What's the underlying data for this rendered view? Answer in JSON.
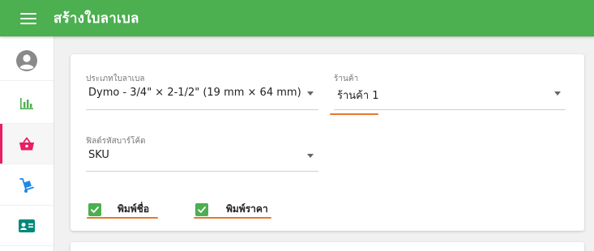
{
  "appbar": {
    "title": "สร้างใบลาเบล",
    "menu_icon": "hamburger-menu-icon"
  },
  "sidebar": {
    "accent": "#e91e63",
    "items": [
      {
        "icon": "user-profile-icon",
        "color": "#888888",
        "active": false
      },
      {
        "icon": "bar-chart-icon",
        "color": "#4caf50",
        "active": false
      },
      {
        "icon": "shopping-basket-icon",
        "color": "#e91e63",
        "active": true
      },
      {
        "icon": "hand-truck-icon",
        "color": "#1e88e5",
        "active": false
      },
      {
        "icon": "id-card-icon",
        "color": "#00897b",
        "active": false
      }
    ]
  },
  "form": {
    "label_type": {
      "label": "ประเภทใบลาเบล",
      "value": "Dymo - 3/4\" × 2-1/2\" (19 mm × 64 mm)"
    },
    "shop": {
      "label": "ร้านค้า",
      "value": "ร้านค้า 1"
    },
    "barcode_field": {
      "label": "ฟิลด์รหัสบาร์โค้ด",
      "value": "SKU"
    },
    "print_name": {
      "label": "พิมพ์ชื่อ",
      "checked": true
    },
    "print_price": {
      "label": "พิมพ์ราคา",
      "checked": true
    }
  },
  "colors": {
    "appbar": "#4caf50",
    "checkbox": "#4caf50",
    "highlight": "#e8772e"
  }
}
